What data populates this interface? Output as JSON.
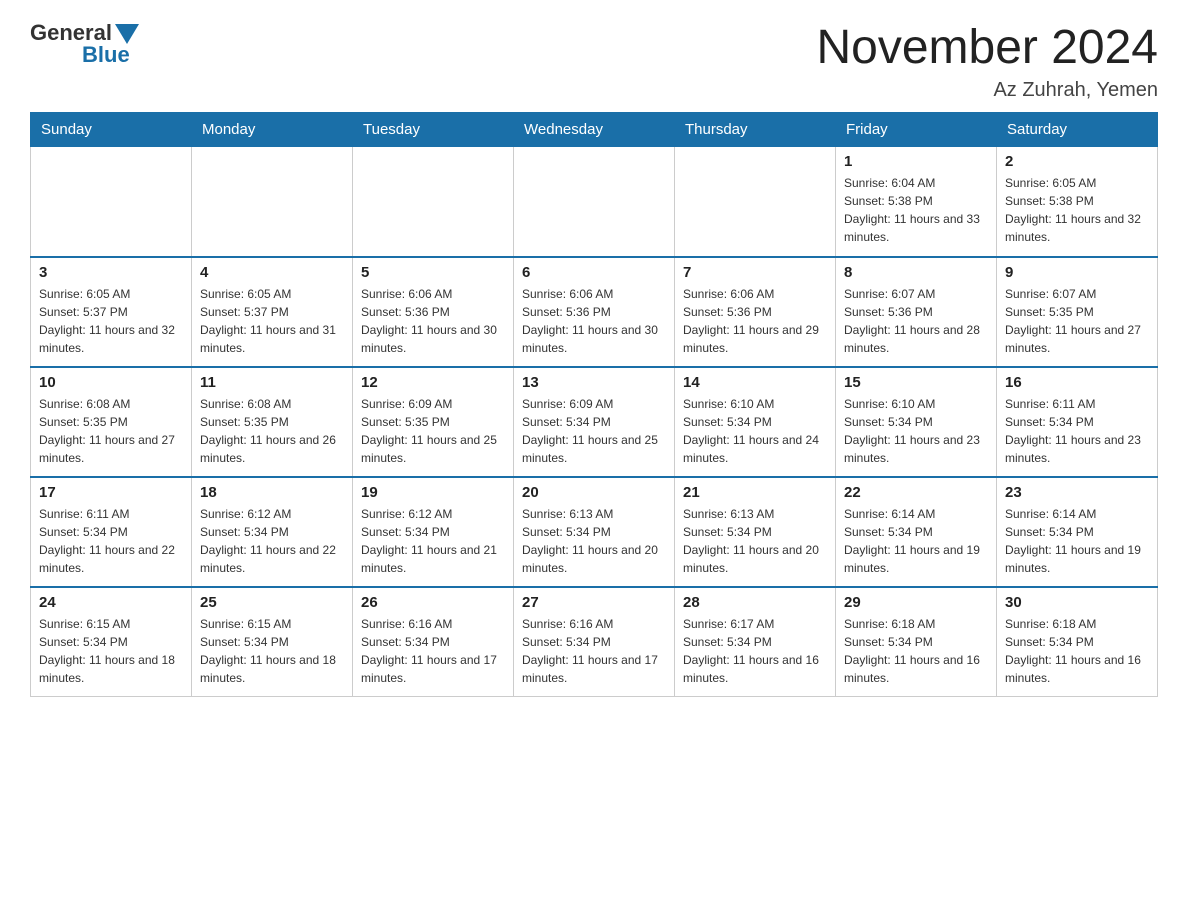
{
  "logo": {
    "general": "General",
    "blue": "Blue"
  },
  "header": {
    "title": "November 2024",
    "location": "Az Zuhrah, Yemen"
  },
  "weekdays": [
    "Sunday",
    "Monday",
    "Tuesday",
    "Wednesday",
    "Thursday",
    "Friday",
    "Saturday"
  ],
  "weeks": [
    [
      {
        "day": "",
        "info": ""
      },
      {
        "day": "",
        "info": ""
      },
      {
        "day": "",
        "info": ""
      },
      {
        "day": "",
        "info": ""
      },
      {
        "day": "",
        "info": ""
      },
      {
        "day": "1",
        "info": "Sunrise: 6:04 AM\nSunset: 5:38 PM\nDaylight: 11 hours and 33 minutes."
      },
      {
        "day": "2",
        "info": "Sunrise: 6:05 AM\nSunset: 5:38 PM\nDaylight: 11 hours and 32 minutes."
      }
    ],
    [
      {
        "day": "3",
        "info": "Sunrise: 6:05 AM\nSunset: 5:37 PM\nDaylight: 11 hours and 32 minutes."
      },
      {
        "day": "4",
        "info": "Sunrise: 6:05 AM\nSunset: 5:37 PM\nDaylight: 11 hours and 31 minutes."
      },
      {
        "day": "5",
        "info": "Sunrise: 6:06 AM\nSunset: 5:36 PM\nDaylight: 11 hours and 30 minutes."
      },
      {
        "day": "6",
        "info": "Sunrise: 6:06 AM\nSunset: 5:36 PM\nDaylight: 11 hours and 30 minutes."
      },
      {
        "day": "7",
        "info": "Sunrise: 6:06 AM\nSunset: 5:36 PM\nDaylight: 11 hours and 29 minutes."
      },
      {
        "day": "8",
        "info": "Sunrise: 6:07 AM\nSunset: 5:36 PM\nDaylight: 11 hours and 28 minutes."
      },
      {
        "day": "9",
        "info": "Sunrise: 6:07 AM\nSunset: 5:35 PM\nDaylight: 11 hours and 27 minutes."
      }
    ],
    [
      {
        "day": "10",
        "info": "Sunrise: 6:08 AM\nSunset: 5:35 PM\nDaylight: 11 hours and 27 minutes."
      },
      {
        "day": "11",
        "info": "Sunrise: 6:08 AM\nSunset: 5:35 PM\nDaylight: 11 hours and 26 minutes."
      },
      {
        "day": "12",
        "info": "Sunrise: 6:09 AM\nSunset: 5:35 PM\nDaylight: 11 hours and 25 minutes."
      },
      {
        "day": "13",
        "info": "Sunrise: 6:09 AM\nSunset: 5:34 PM\nDaylight: 11 hours and 25 minutes."
      },
      {
        "day": "14",
        "info": "Sunrise: 6:10 AM\nSunset: 5:34 PM\nDaylight: 11 hours and 24 minutes."
      },
      {
        "day": "15",
        "info": "Sunrise: 6:10 AM\nSunset: 5:34 PM\nDaylight: 11 hours and 23 minutes."
      },
      {
        "day": "16",
        "info": "Sunrise: 6:11 AM\nSunset: 5:34 PM\nDaylight: 11 hours and 23 minutes."
      }
    ],
    [
      {
        "day": "17",
        "info": "Sunrise: 6:11 AM\nSunset: 5:34 PM\nDaylight: 11 hours and 22 minutes."
      },
      {
        "day": "18",
        "info": "Sunrise: 6:12 AM\nSunset: 5:34 PM\nDaylight: 11 hours and 22 minutes."
      },
      {
        "day": "19",
        "info": "Sunrise: 6:12 AM\nSunset: 5:34 PM\nDaylight: 11 hours and 21 minutes."
      },
      {
        "day": "20",
        "info": "Sunrise: 6:13 AM\nSunset: 5:34 PM\nDaylight: 11 hours and 20 minutes."
      },
      {
        "day": "21",
        "info": "Sunrise: 6:13 AM\nSunset: 5:34 PM\nDaylight: 11 hours and 20 minutes."
      },
      {
        "day": "22",
        "info": "Sunrise: 6:14 AM\nSunset: 5:34 PM\nDaylight: 11 hours and 19 minutes."
      },
      {
        "day": "23",
        "info": "Sunrise: 6:14 AM\nSunset: 5:34 PM\nDaylight: 11 hours and 19 minutes."
      }
    ],
    [
      {
        "day": "24",
        "info": "Sunrise: 6:15 AM\nSunset: 5:34 PM\nDaylight: 11 hours and 18 minutes."
      },
      {
        "day": "25",
        "info": "Sunrise: 6:15 AM\nSunset: 5:34 PM\nDaylight: 11 hours and 18 minutes."
      },
      {
        "day": "26",
        "info": "Sunrise: 6:16 AM\nSunset: 5:34 PM\nDaylight: 11 hours and 17 minutes."
      },
      {
        "day": "27",
        "info": "Sunrise: 6:16 AM\nSunset: 5:34 PM\nDaylight: 11 hours and 17 minutes."
      },
      {
        "day": "28",
        "info": "Sunrise: 6:17 AM\nSunset: 5:34 PM\nDaylight: 11 hours and 16 minutes."
      },
      {
        "day": "29",
        "info": "Sunrise: 6:18 AM\nSunset: 5:34 PM\nDaylight: 11 hours and 16 minutes."
      },
      {
        "day": "30",
        "info": "Sunrise: 6:18 AM\nSunset: 5:34 PM\nDaylight: 11 hours and 16 minutes."
      }
    ]
  ]
}
